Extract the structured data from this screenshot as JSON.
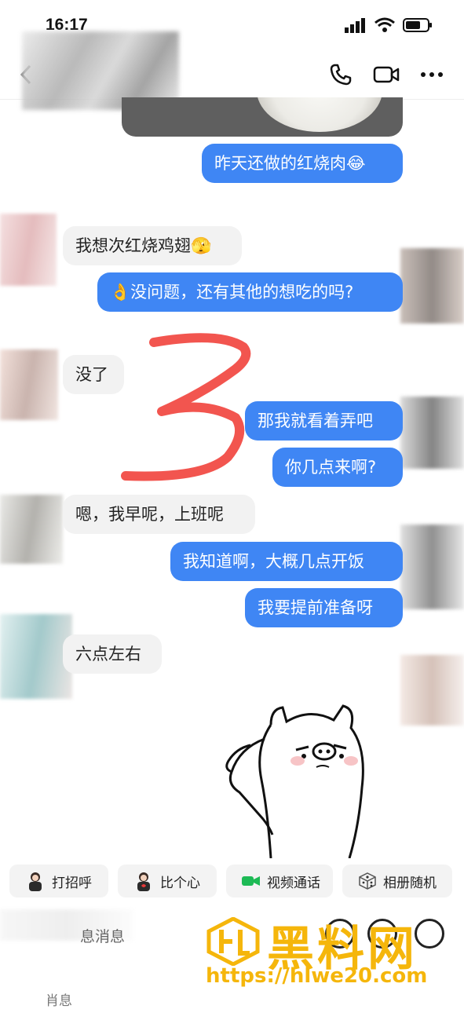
{
  "status_bar": {
    "time": "16:17"
  },
  "chat": {
    "messages": [
      {
        "from": "me",
        "text": "昨天还做的红烧肉😂"
      },
      {
        "from": "them",
        "text": "我想次红烧鸡翅🫣"
      },
      {
        "from": "me",
        "text": "👌没问题，还有其他的想吃的吗?"
      },
      {
        "from": "them",
        "text": "没了"
      },
      {
        "from": "me",
        "text": "那我就看着弄吧"
      },
      {
        "from": "me",
        "text": "你几点来啊?"
      },
      {
        "from": "them",
        "text": "嗯，我早呢，上班呢"
      },
      {
        "from": "me",
        "text": "我知道啊，大概几点开饭"
      },
      {
        "from": "me",
        "text": "我要提前准备呀"
      },
      {
        "from": "them",
        "text": "六点左右"
      }
    ]
  },
  "quick_actions": [
    {
      "label": "打招呼",
      "icon": "avatar-greet-icon"
    },
    {
      "label": "比个心",
      "icon": "avatar-heart-icon"
    },
    {
      "label": "视频通话",
      "icon": "video-call-icon"
    },
    {
      "label": "相册随机",
      "icon": "dice-icon"
    }
  ],
  "input": {
    "placeholder": "息消息",
    "placeholder_second_line": "肖息"
  },
  "watermark": {
    "title": "黑料网",
    "url": "https://hlwe20.com"
  },
  "colors": {
    "accent": "#3f86f4",
    "received_bubble": "#f2f2f2",
    "annotation": "#f2554f",
    "watermark": "#f5b60b"
  }
}
